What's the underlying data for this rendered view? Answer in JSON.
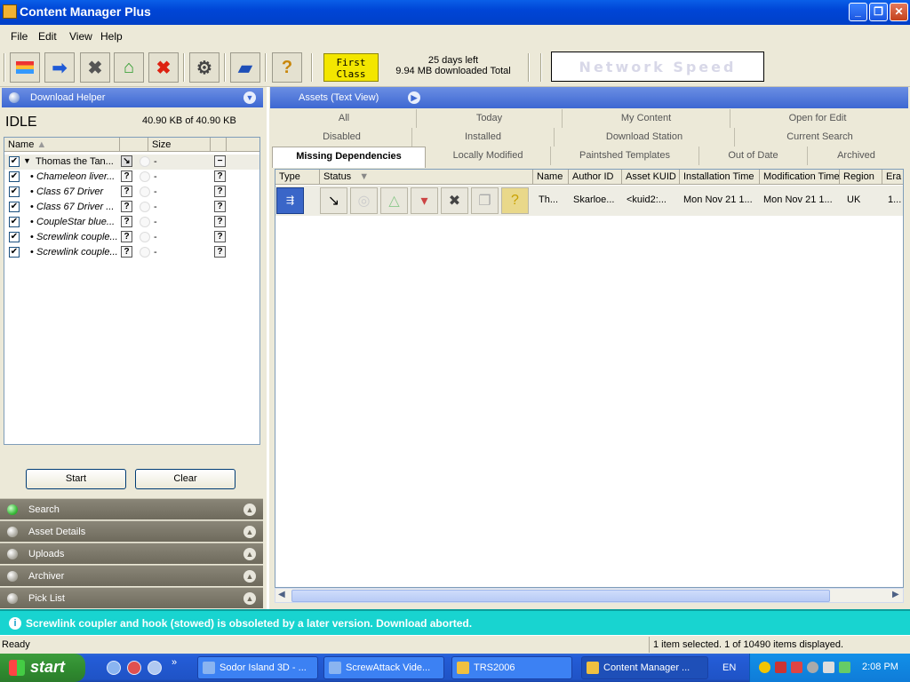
{
  "window": {
    "title": "Content Manager Plus"
  },
  "menu": [
    "File",
    "Edit",
    "View",
    "Help"
  ],
  "toolbar": {
    "badge_line1": "First",
    "badge_line2": "Class",
    "days_left": "25 days left",
    "downloaded": "9.94 MB downloaded Total",
    "network_speed": "Network Speed"
  },
  "download_helper": {
    "header": "Download Helper",
    "state": "IDLE",
    "size": "40.90 KB of 40.90 KB",
    "col_name": "Name",
    "col_size": "Size",
    "items": [
      {
        "name": "Thomas the Tan...",
        "size": "-"
      },
      {
        "name": "Chameleon liver...",
        "size": "-"
      },
      {
        "name": "Class 67 Driver",
        "size": "-"
      },
      {
        "name": "Class 67 Driver ...",
        "size": "-"
      },
      {
        "name": "CoupleStar blue...",
        "size": "-"
      },
      {
        "name": "Screwlink couple...",
        "size": "-"
      },
      {
        "name": "Screwlink couple...",
        "size": "-"
      }
    ],
    "start_label": "Start",
    "clear_label": "Clear"
  },
  "left_sections": [
    "Search",
    "Asset Details",
    "Uploads",
    "Archiver",
    "Pick List"
  ],
  "assets": {
    "header": "Assets (Text View)",
    "tabs_row1": [
      "All",
      "Today",
      "My Content",
      "Open for Edit"
    ],
    "tabs_row2": [
      "Disabled",
      "Installed",
      "Download Station",
      "Current Search"
    ],
    "tabs_row3": [
      "Missing Dependencies",
      "Locally Modified",
      "Paintshed Templates",
      "Out of Date",
      "Archived"
    ],
    "columns": [
      "Type",
      "Status",
      "Name",
      "Author ID",
      "Asset KUID",
      "Installation Time",
      "Modification Time",
      "Region",
      "Era"
    ],
    "row": {
      "name": "Th...",
      "author": "Skarloe...",
      "kuid": "<kuid2:...",
      "install_time": "Mon Nov 21 1...",
      "mod_time": "Mon Nov 21 1...",
      "region": "UK",
      "era": "1..."
    }
  },
  "message": "Screwlink coupler and hook (stowed) is obsoleted by a later version. Download aborted.",
  "status": {
    "left": "Ready",
    "right": "1 item selected. 1 of 10490 items displayed."
  },
  "taskbar": {
    "start": "start",
    "tasks": [
      "Sodor Island 3D - ...",
      "ScrewAttack Vide...",
      "TRS2006",
      "Content Manager ..."
    ],
    "lang": "EN",
    "clock": "2:08 PM"
  }
}
